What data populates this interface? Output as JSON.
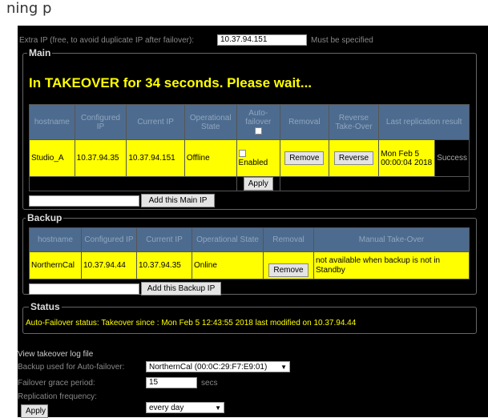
{
  "page_header": {
    "partial_text": "ning p"
  },
  "extra_ip": {
    "label": "Extra IP (free, to avoid duplicate IP after failover):",
    "value": "10.37.94.151",
    "note": "Must be specified"
  },
  "main": {
    "legend": "Main",
    "takeover_message": "In TAKEOVER for 34 seconds. Please wait...",
    "headers": [
      "hostname",
      "Configured IP",
      "Current IP",
      "Operational State",
      "Auto-failover",
      "Removal",
      "Reverse Take-Over",
      "Last replication result"
    ],
    "row": {
      "hostname": "Studio_A",
      "configured_ip": "10.37.94.35",
      "current_ip": "10.37.94.151",
      "state": "Offline",
      "enabled_label": "Enabled",
      "remove_label": "Remove",
      "reverse_label": "Reverse",
      "last_replication_time": "Mon Feb 5 00:00:04 2018",
      "last_replication_result": "Success"
    },
    "apply_label": "Apply",
    "add_button": "Add this Main IP"
  },
  "backup": {
    "legend": "Backup",
    "headers": [
      "hostname",
      "Configured IP",
      "Current IP",
      "Operational State",
      "Removal",
      "Manual Take-Over"
    ],
    "row": {
      "hostname": "NorthernCal",
      "configured_ip": "10.37.94.44",
      "current_ip": "10.37.94.35",
      "state": "Online",
      "remove_label": "Remove",
      "manual_takeover": "not available when backup is not in Standby"
    },
    "add_button": "Add this Backup IP"
  },
  "status": {
    "legend": "Status",
    "text": "Auto-Failover status: Takeover since : Mon Feb 5 12:43:55 2018 last modified on 10.37.94.44"
  },
  "footer": {
    "log_link": "View takeover log file",
    "backup_label": "Backup used for Auto-failover:",
    "backup_value": "NorthernCal (00:0C:29:F7:E9:01)",
    "grace_label": "Failover grace period:",
    "grace_value": "15",
    "grace_unit": "secs",
    "replication_label": "Replication frequency:",
    "replication_value": "every day",
    "apply_label": "Apply"
  },
  "colors": {
    "highlight": "#ffff00",
    "header_bg": "#4d6b8e",
    "background": "#000000"
  }
}
